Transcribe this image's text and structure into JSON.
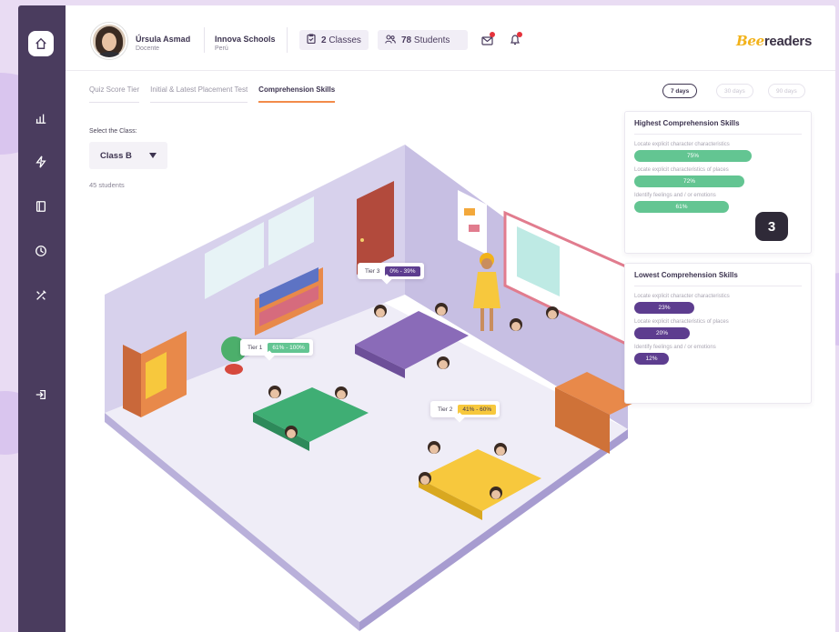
{
  "header": {
    "teacher_name": "Úrsula Asmad",
    "teacher_role": "Docente",
    "school_name": "Innova Schools",
    "school_country": "Perú",
    "classes_count": "2",
    "classes_label": "Classes",
    "students_count": "78",
    "students_label": "Students",
    "logo_prefix": "Bee",
    "logo_suffix": "readers"
  },
  "tabs": [
    {
      "label": "Quiz Score Tier",
      "active": false
    },
    {
      "label": "Initial & Latest Placement Test",
      "active": false
    },
    {
      "label": "Comprehension Skills",
      "active": true
    }
  ],
  "ranges": [
    {
      "label": "7 days",
      "active": true
    },
    {
      "label": "30 days",
      "active": false
    },
    {
      "label": "90 days",
      "active": false
    }
  ],
  "class_select": {
    "label": "Select the Class:",
    "value": "Class B",
    "students": "45 students"
  },
  "highest": {
    "title": "Highest Comprehension Skills",
    "items": [
      {
        "label": "Locate explicit character characteristics",
        "value": "75%",
        "fraction": 0.75
      },
      {
        "label": "Locate explicit characteristics of places",
        "value": "72%",
        "fraction": 0.72
      },
      {
        "label": "Identify feelings and / or emotions",
        "value": "61%",
        "fraction": 0.61
      }
    ]
  },
  "lowest": {
    "title": "Lowest Comprehension Skills",
    "items": [
      {
        "label": "Locate explicit character characteristics",
        "value": "23%",
        "fraction": 0.23
      },
      {
        "label": "Locate explicit characteristics of places",
        "value": "20%",
        "fraction": 0.2
      },
      {
        "label": "Identify feelings and / or emotions",
        "value": "12%",
        "fraction": 0.12
      }
    ]
  },
  "step_badge": "3",
  "tiers": [
    {
      "name": "Tier 1",
      "range": "61% - 100%",
      "color": "#63c592"
    },
    {
      "name": "Tier 2",
      "range": "41% - 60%",
      "color": "#f7c83d"
    },
    {
      "name": "Tier 3",
      "range": "0% - 39%",
      "color": "#5d3d8f"
    }
  ],
  "colors": {
    "sidebar": "#4a3c5e",
    "green": "#63c592",
    "purple": "#5d3d8f",
    "yellow": "#f7c83d",
    "accent": "#f28b4a"
  }
}
